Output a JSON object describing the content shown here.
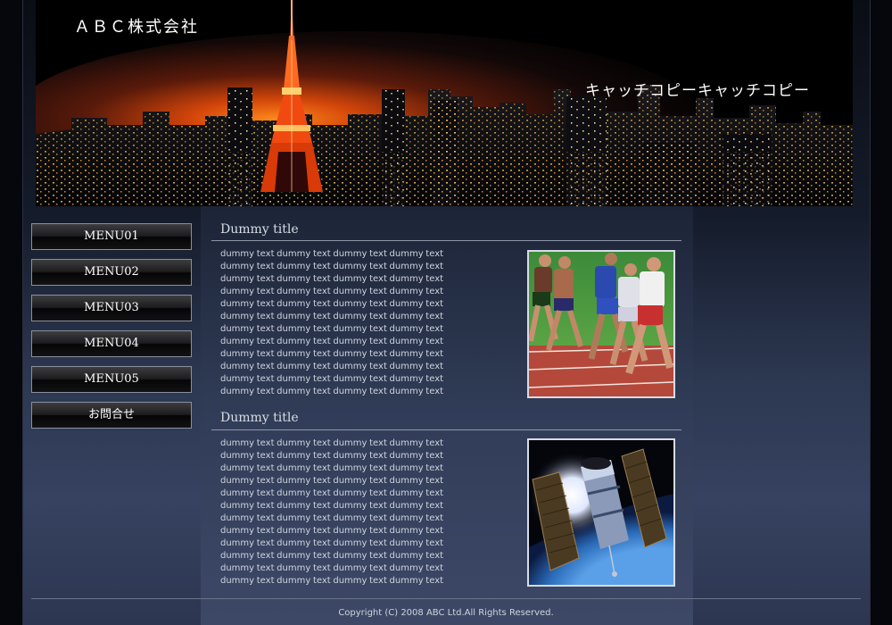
{
  "header": {
    "logo": "ＡＢＣ株式会社",
    "catchcopy": "キャッチコピーキャッチコピー"
  },
  "sidebar": {
    "items": [
      {
        "label": "MENU01"
      },
      {
        "label": "MENU02"
      },
      {
        "label": "MENU03"
      },
      {
        "label": "MENU04"
      },
      {
        "label": "MENU05"
      },
      {
        "label": "お問合せ"
      }
    ]
  },
  "sections": [
    {
      "title": "Dummy title",
      "lines": [
        "dummy text dummy text dummy text dummy text",
        "dummy text dummy text dummy text dummy text",
        "dummy text dummy text dummy text dummy text",
        "dummy text dummy text dummy text dummy text",
        "dummy text dummy text dummy text dummy text",
        "dummy text dummy text dummy text dummy text",
        "dummy text dummy text dummy text dummy text",
        "dummy text dummy text dummy text dummy text",
        "dummy text dummy text dummy text dummy text",
        "dummy text dummy text dummy text dummy text",
        "dummy text dummy text dummy text dummy text",
        "dummy text dummy text dummy text dummy text"
      ],
      "image": "runners-photo"
    },
    {
      "title": "Dummy title",
      "lines": [
        "dummy text dummy text dummy text dummy text",
        "dummy text dummy text dummy text dummy text",
        "dummy text dummy text dummy text dummy text",
        "dummy text dummy text dummy text dummy text",
        "dummy text dummy text dummy text dummy text",
        "dummy text dummy text dummy text dummy text",
        "dummy text dummy text dummy text dummy text",
        "dummy text dummy text dummy text dummy text",
        "dummy text dummy text dummy text dummy text",
        "dummy text dummy text dummy text dummy text",
        "dummy text dummy text dummy text dummy text",
        "dummy text dummy text dummy text dummy text"
      ],
      "image": "satellite-photo"
    }
  ],
  "footer": {
    "copyright": "Copyright (C) 2008 ABC Ltd.All Rights Reserved."
  },
  "colors": {
    "frame_bg": "#0a0d14",
    "content_bg": "#313d58",
    "text": "#cfd4de",
    "button_border": "#8a8f9a"
  }
}
